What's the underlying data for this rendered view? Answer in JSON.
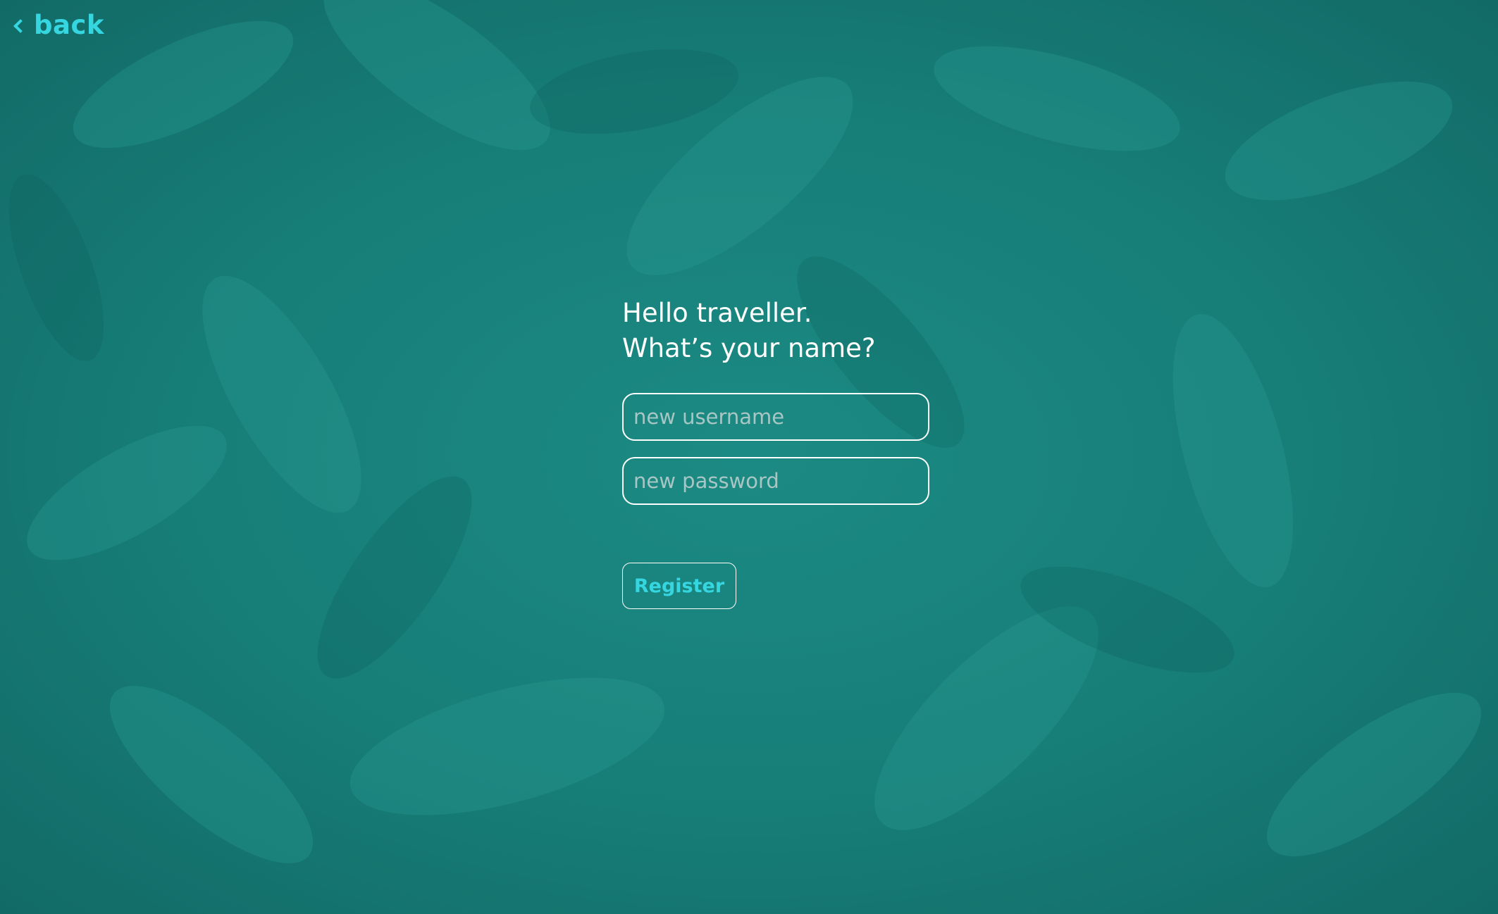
{
  "nav": {
    "back_label": "back"
  },
  "greeting": {
    "line1": "Hello traveller.",
    "line2": "What’s your name?"
  },
  "form": {
    "username_placeholder": "new username",
    "password_placeholder": "new password",
    "register_label": "Register"
  },
  "colors": {
    "background": "#17807a",
    "accent": "#35d6e0",
    "text": "#ffffff"
  },
  "icons": {
    "back": "chevron-left-icon"
  }
}
